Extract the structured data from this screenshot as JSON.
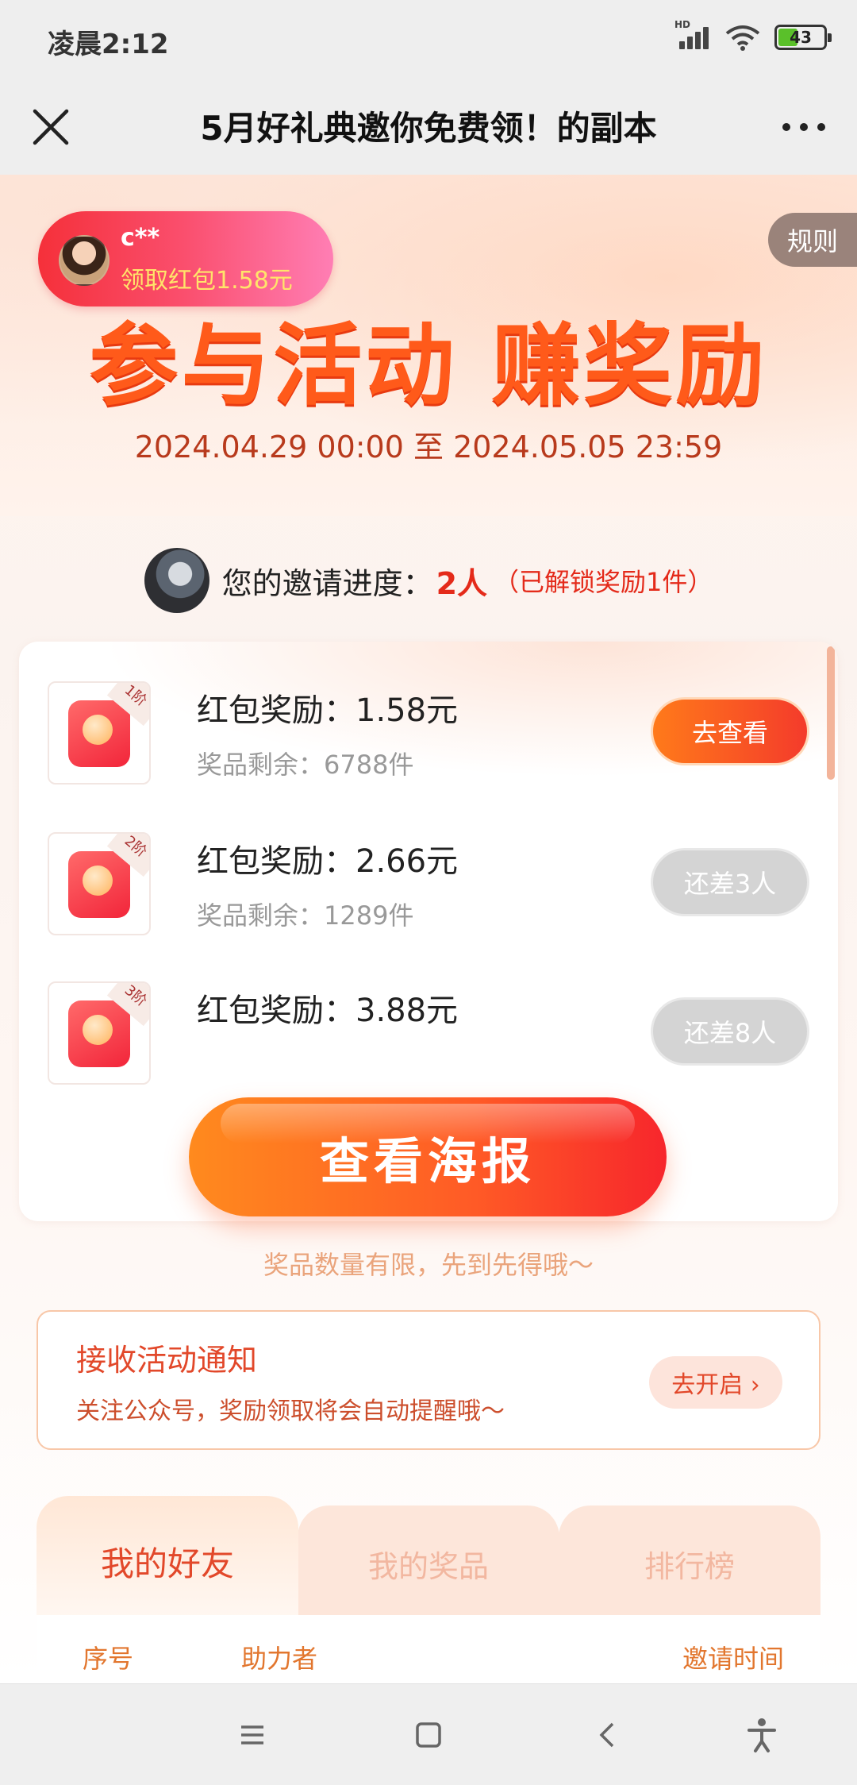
{
  "status_bar": {
    "time": "凌晨2:12",
    "hd": "HD",
    "battery": "43",
    "battery_level": 0.43,
    "icons": [
      "signal-icon",
      "wifi-icon",
      "battery-icon"
    ]
  },
  "title_bar": {
    "title": "5月好礼典邀你免费领！的副本",
    "close_icon": "close-icon",
    "more_icon": "more-icon"
  },
  "hero": {
    "title": "参与活动 赚奖励",
    "date_range": "2024.04.29 00:00 至 2024.05.05 23:59",
    "rules_label": "规则"
  },
  "toast": {
    "name": "c**",
    "text": "领取红包1.58元"
  },
  "progress": {
    "label": "您的邀请进度：",
    "count": "2人",
    "note": "（已解锁奖励1件）"
  },
  "rewards": [
    {
      "tier": "1阶",
      "title": "红包奖励：1.58元",
      "stock": "奖品剩余：6788件",
      "button": "去查看",
      "state": "active"
    },
    {
      "tier": "2阶",
      "title": "红包奖励：2.66元",
      "stock": "奖品剩余：1289件",
      "button": "还差3人",
      "state": "disabled"
    },
    {
      "tier": "3阶",
      "title": "红包奖励：3.88元",
      "stock": "",
      "button": "还差8人",
      "state": "disabled"
    }
  ],
  "poster": {
    "button": "查看海报",
    "note": "奖品数量有限，先到先得哦～"
  },
  "notify": {
    "title": "接收活动通知",
    "desc": "关注公众号，奖励领取将会自动提醒哦～",
    "button": "去开启 ›"
  },
  "tabs": [
    "我的好友",
    "我的奖品",
    "排行榜"
  ],
  "table_headers": [
    "序号",
    "助力者",
    "邀请时间"
  ],
  "colors": {
    "accent": "#ff5a1a",
    "accent_red": "#e42a1a",
    "disabled": "#d4d4d4"
  },
  "nav_bar": [
    "menu-icon",
    "home-icon",
    "back-icon",
    "accessibility-icon"
  ]
}
